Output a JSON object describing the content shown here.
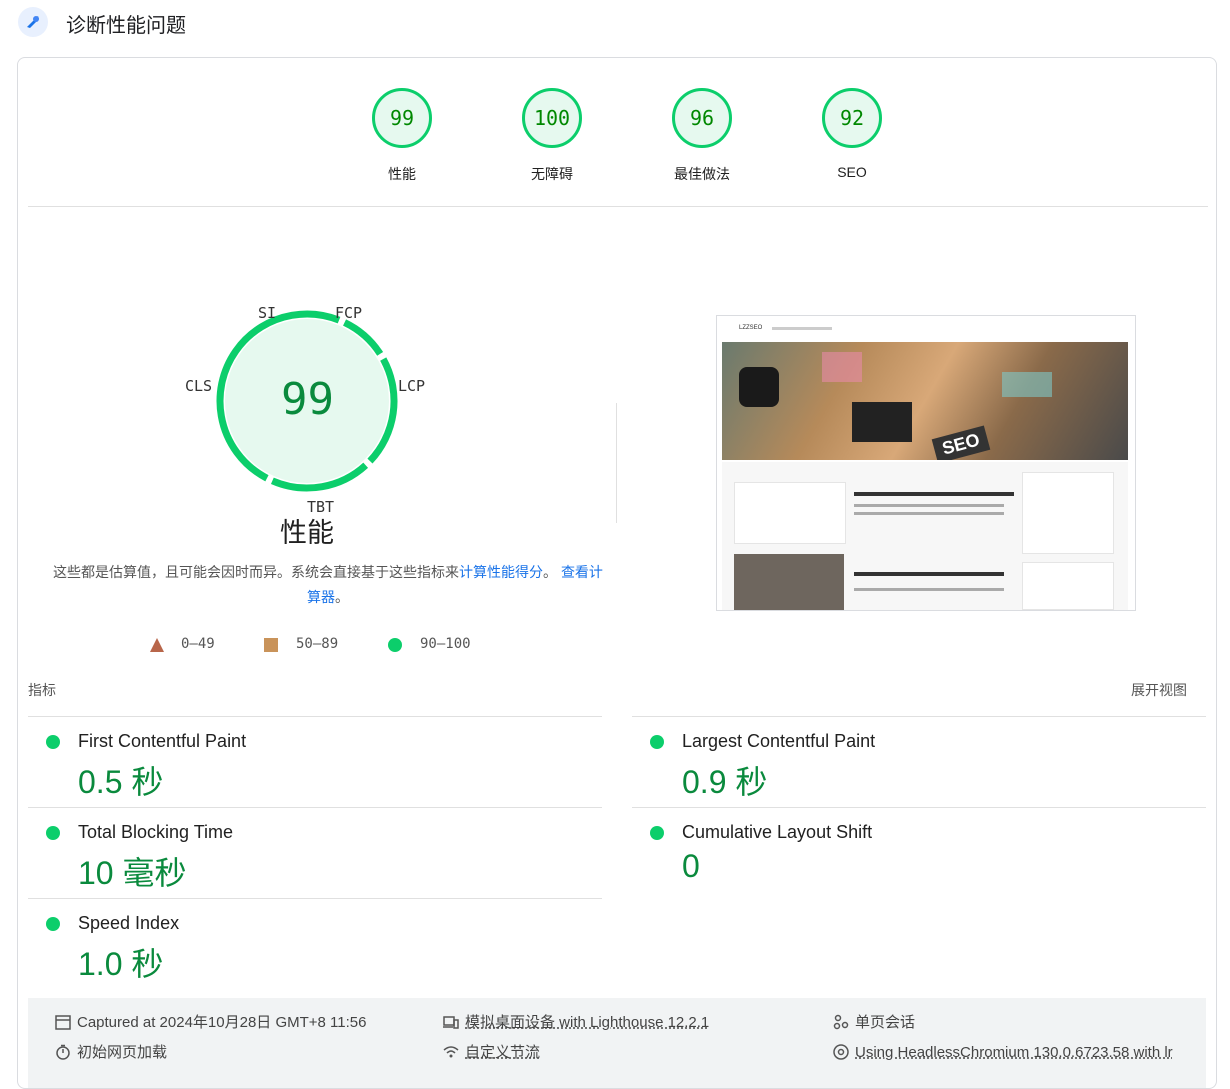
{
  "header": {
    "title": "诊断性能问题"
  },
  "categories": [
    {
      "score": "99",
      "label": "性能"
    },
    {
      "score": "100",
      "label": "无障碍"
    },
    {
      "score": "96",
      "label": "最佳做法"
    },
    {
      "score": "92",
      "label": "SEO"
    }
  ],
  "performance": {
    "score": "99",
    "label": "性能",
    "tags": {
      "si": "SI",
      "fcp": "FCP",
      "lcp": "LCP",
      "tbt": "TBT",
      "cls": "CLS"
    },
    "desc_before": "这些都是估算值，且可能会因时而异。系统会直接基于这些指标来",
    "desc_link1": "计算性能得分",
    "desc_mid": "。",
    "desc_link2": "查看计算器",
    "desc_after": "。",
    "legend": [
      "0–49",
      "50–89",
      "90–100"
    ]
  },
  "screenshot": {
    "site": "LZZSEO",
    "badge": "SEO"
  },
  "metrics_section": {
    "title": "指标",
    "expand": "展开视图"
  },
  "metrics": [
    {
      "title": "First Contentful Paint",
      "value": "0.5 秒"
    },
    {
      "title": "Largest Contentful Paint",
      "value": "0.9 秒"
    },
    {
      "title": "Total Blocking Time",
      "value": "10 毫秒"
    },
    {
      "title": "Cumulative Layout Shift",
      "value": "0"
    },
    {
      "title": "Speed Index",
      "value": "1.0 秒"
    }
  ],
  "footer": {
    "captured": "Captured at 2024年10月28日 GMT+8 11:56",
    "initial_load": "初始网页加载",
    "device": "模拟桌面设备 with Lighthouse 12.2.1",
    "throttling": "自定义节流",
    "session": "单页会话",
    "browser": "Using HeadlessChromium 130.0.6723.58 with lr"
  },
  "colors": {
    "pass": "#0cce6b",
    "average": "#ffa400",
    "fail": "#ff4e42",
    "link": "#1a73e8"
  }
}
